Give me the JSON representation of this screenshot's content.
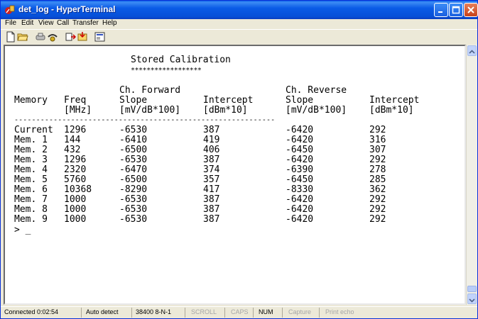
{
  "window": {
    "title": "det_log - HyperTerminal"
  },
  "menu": [
    "File",
    "Edit",
    "View",
    "Call",
    "Transfer",
    "Help"
  ],
  "toolbar": [
    "new-connection-icon",
    "open-icon",
    "disconnect-icon",
    "hangup-icon",
    "send-icon",
    "receive-icon",
    "properties-icon"
  ],
  "terminal": {
    "heading": "Stored Calibration",
    "underline": "******************",
    "headers": {
      "memory": [
        "Memory"
      ],
      "freq": [
        "Freq",
        "[MHz]"
      ],
      "fwd_slope": [
        "Ch. Forward",
        "Slope",
        "[mV/dB*100]"
      ],
      "fwd_intercept": [
        "Intercept",
        "[dBm*10]"
      ],
      "rev_slope": [
        "Ch. Reverse",
        "Slope",
        "[mV/dB*100]"
      ],
      "rev_intercept": [
        "Intercept",
        "[dBm*10]"
      ]
    },
    "separator": "------------------------------------------------------------",
    "rows": [
      [
        "Current",
        "1296",
        "-6530",
        "387",
        "-6420",
        "292"
      ],
      [
        "Mem. 1",
        "144",
        "-6410",
        "419",
        "-6420",
        "316"
      ],
      [
        "Mem. 2",
        "432",
        "-6500",
        "406",
        "-6450",
        "307"
      ],
      [
        "Mem. 3",
        "1296",
        "-6530",
        "387",
        "-6420",
        "292"
      ],
      [
        "Mem. 4",
        "2320",
        "-6470",
        "374",
        "-6390",
        "278"
      ],
      [
        "Mem. 5",
        "5760",
        "-6500",
        "357",
        "-6450",
        "285"
      ],
      [
        "Mem. 6",
        "10368",
        "-8290",
        "417",
        "-8330",
        "362"
      ],
      [
        "Mem. 7",
        "1000",
        "-6530",
        "387",
        "-6420",
        "292"
      ],
      [
        "Mem. 8",
        "1000",
        "-6530",
        "387",
        "-6420",
        "292"
      ],
      [
        "Mem. 9",
        "1000",
        "-6530",
        "387",
        "-6420",
        "292"
      ]
    ],
    "prompt": "> _"
  },
  "status": {
    "connected": "Connected 0:02:54",
    "detect": "Auto detect",
    "settings": "38400 8-N-1",
    "scroll": "SCROLL",
    "caps": "CAPS",
    "num": "NUM",
    "capture": "Capture",
    "print_echo": "Print echo"
  }
}
